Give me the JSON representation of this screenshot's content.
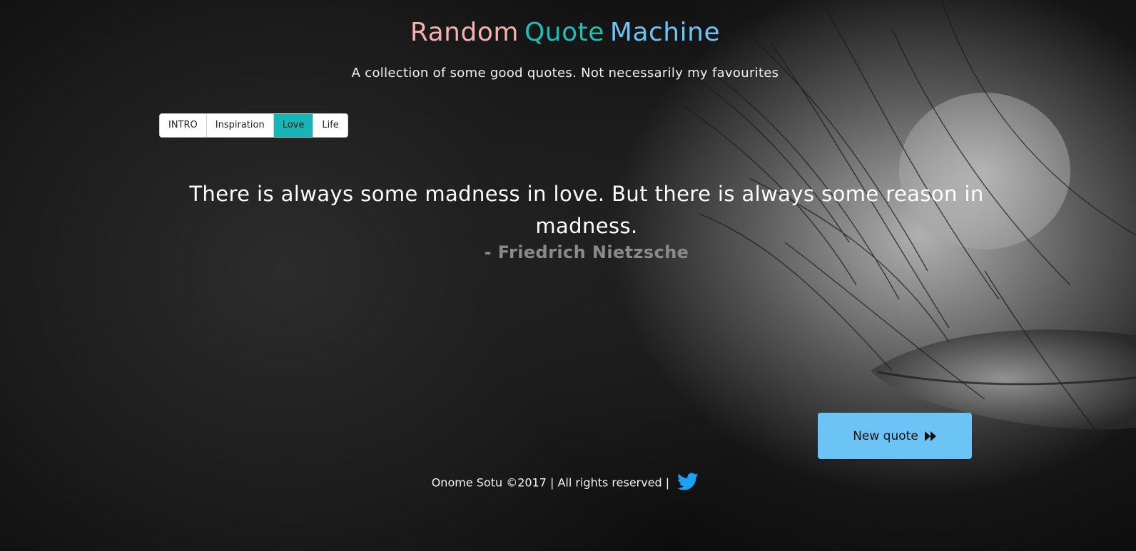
{
  "header": {
    "title_words": [
      "Random",
      "Quote",
      "Machine"
    ],
    "subtitle": "A collection of some good quotes. Not necessarily my favourites"
  },
  "tabs": [
    {
      "label": "INTRO",
      "active": false
    },
    {
      "label": "Inspiration",
      "active": false
    },
    {
      "label": "Love",
      "active": true
    },
    {
      "label": "Life",
      "active": false
    }
  ],
  "quote": {
    "text": "There is always some madness in love. But there is always some reason in madness.",
    "author": "- Friedrich Nietzsche"
  },
  "actions": {
    "new_quote_label": "New quote",
    "new_quote_icon": "fast-forward-icon"
  },
  "footer": {
    "text": "Onome Sotu ©2017 | All rights reserved |",
    "social_icon": "twitter-icon"
  },
  "colors": {
    "title_random": "#f5b0b0",
    "title_quote": "#17c0b8",
    "title_machine": "#6cc3f5",
    "tab_active": "#17b5b5",
    "button": "#6cc3f5",
    "twitter": "#1da1f2",
    "author": "#8a8a8a"
  }
}
